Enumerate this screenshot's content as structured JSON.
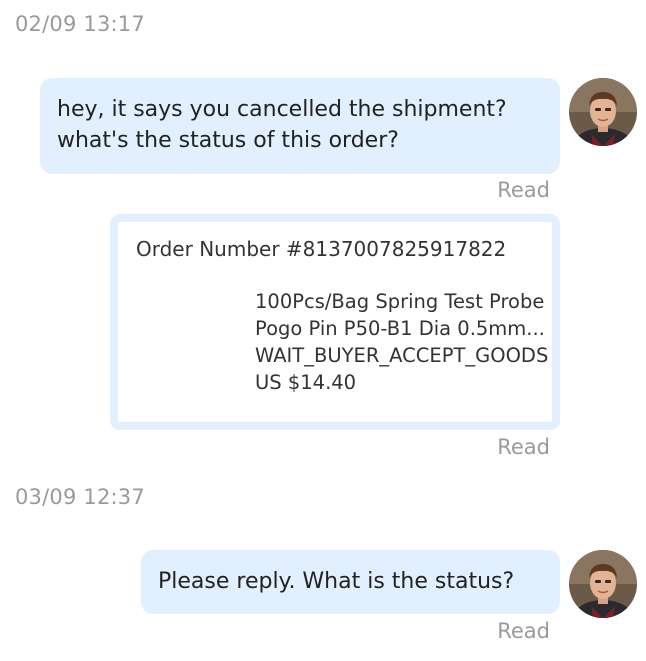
{
  "conversation": {
    "groups": [
      {
        "timestamp": "02/09 13:17",
        "message_lines": [
          "hey, it says you cancelled the shipment?",
          "what's the status of this order?"
        ],
        "read_label": "Read"
      },
      {
        "order_card": {
          "order_number": "Order Number #8137007825917822",
          "product_line1": "100Pcs/Bag Spring Test Probe",
          "product_line2": "Pogo Pin P50-B1 Dia 0.5mm...",
          "status": "WAIT_BUYER_ACCEPT_GOODS",
          "price": "US $14.40"
        },
        "read_label": "Read"
      },
      {
        "timestamp": "03/09 12:37",
        "message_lines": [
          "Please reply. What is the status?"
        ],
        "read_label": "Read"
      }
    ]
  },
  "colors": {
    "bubble_bg": "#e1efff",
    "meta_text": "#9a9a9a",
    "message_text": "#222222"
  },
  "icons": {
    "avatar": "user-avatar-photo"
  }
}
